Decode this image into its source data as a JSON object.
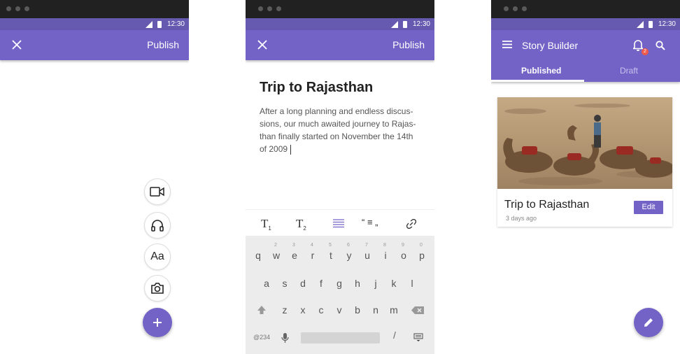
{
  "status_time": "12:30",
  "screen1": {
    "publish_label": "Publish",
    "aa_label": "Aa",
    "icons": [
      "close-icon",
      "video-camera-icon",
      "headphones-icon",
      "text-format-icon",
      "camera-icon",
      "plus-icon"
    ]
  },
  "screen2": {
    "publish_label": "Publish",
    "story_title": "Trip to Rajasthan",
    "body_lines": [
      "After a long planning and endless discus-",
      "sions, our much awaited journey to Rajas-",
      "than finally started on November the 14th",
      "of 2009"
    ],
    "toolbar": {
      "heading1": "T",
      "heading1_sub": "1",
      "heading2": "T",
      "heading2_sub": "2",
      "quote": "“ ≡ „"
    },
    "keyboard": {
      "row1": [
        "q",
        "w",
        "e",
        "r",
        "t",
        "y",
        "u",
        "i",
        "o",
        "p"
      ],
      "row1_nums": [
        "2",
        "3",
        "4",
        "5",
        "6",
        "7",
        "8",
        "9",
        "0"
      ],
      "row2": [
        "a",
        "s",
        "d",
        "f",
        "g",
        "h",
        "j",
        "k",
        "l"
      ],
      "row3": [
        "z",
        "x",
        "c",
        "v",
        "b",
        "n",
        "m"
      ],
      "symbols_label": "@234",
      "slash": "/"
    }
  },
  "screen3": {
    "app_title": "Story Builder",
    "notification_count": "2",
    "tabs": [
      "Published",
      "Draft"
    ],
    "active_tab": "Published",
    "card": {
      "title": "Trip to Rajasthan",
      "date": "3 days ago",
      "edit_label": "Edit"
    }
  },
  "colors": {
    "primary": "#7363c7",
    "status_bar": "#6659b0",
    "badge": "#f05a4a"
  }
}
